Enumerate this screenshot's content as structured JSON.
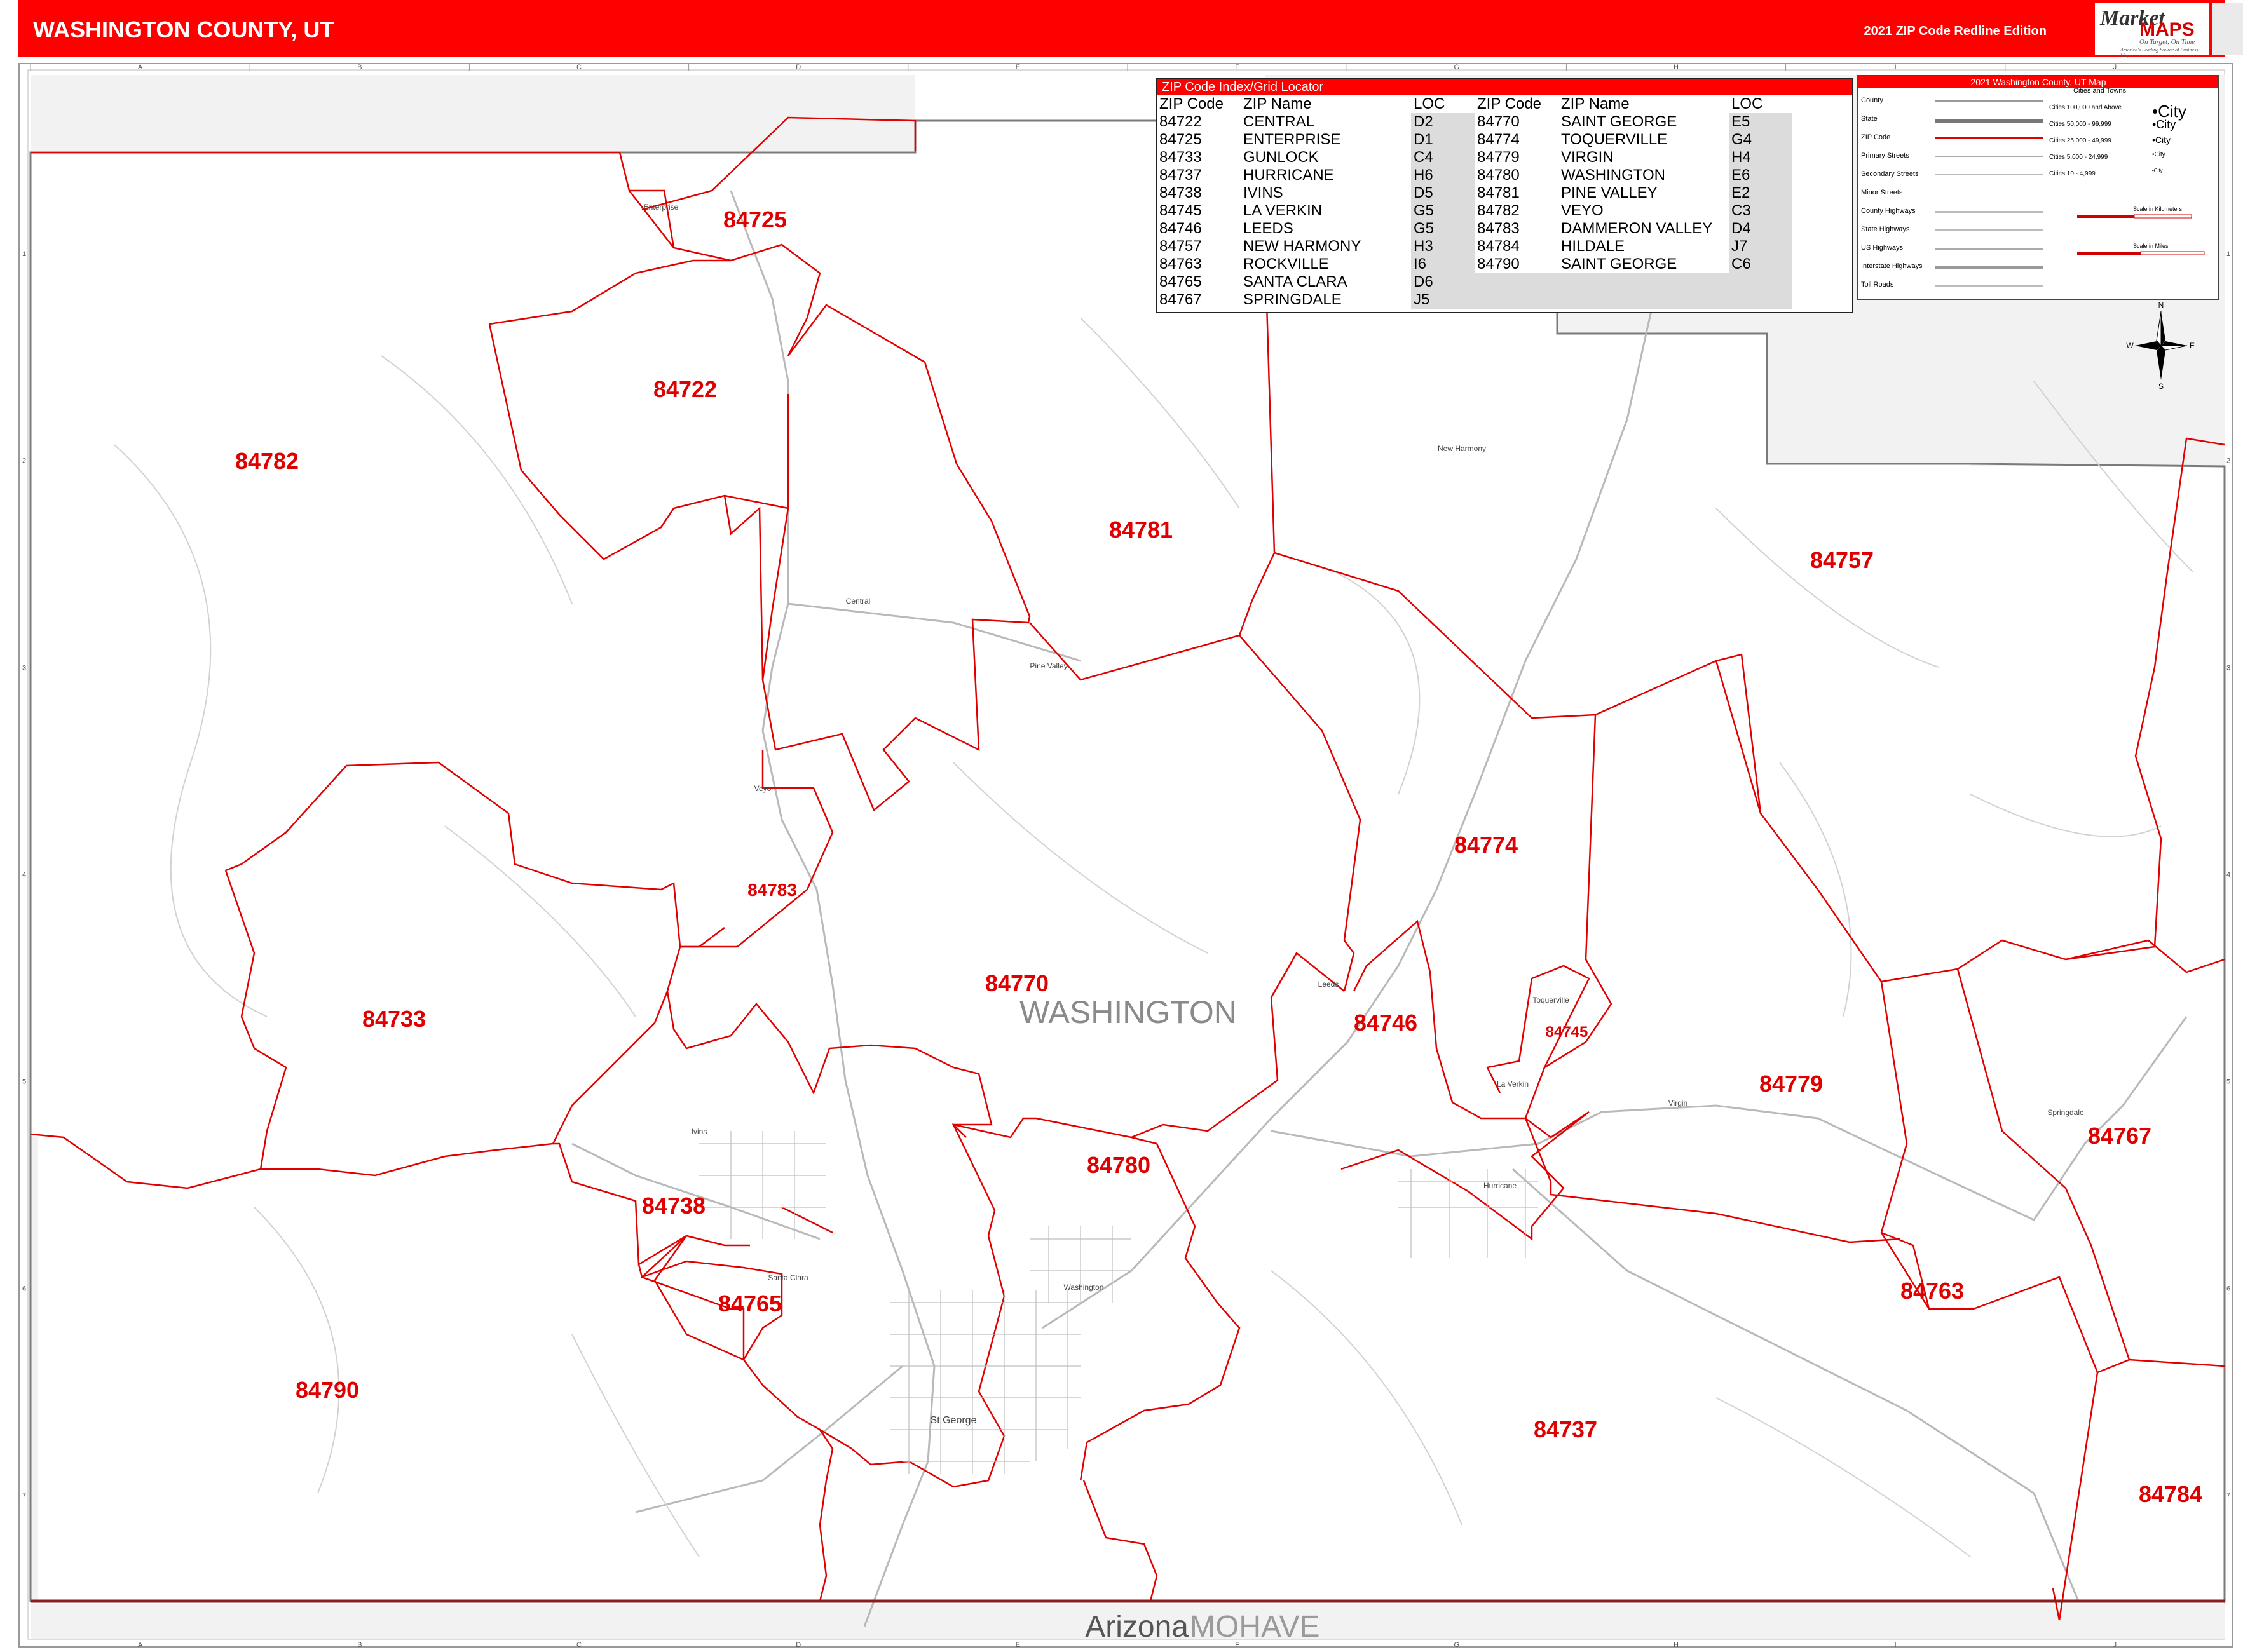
{
  "header": {
    "title": "WASHINGTON COUNTY, UT",
    "edition": "2021 ZIP Code Redline Edition",
    "logo": {
      "market": "Market",
      "maps": "MAPS",
      "tagline": "On Target, On Time",
      "subtagline": "America's Leading Source of Business Maps"
    }
  },
  "grid": {
    "columns": [
      "A",
      "B",
      "C",
      "D",
      "E",
      "F",
      "G",
      "H",
      "I",
      "J"
    ],
    "rows": [
      "1",
      "2",
      "3",
      "4",
      "5",
      "6",
      "7"
    ]
  },
  "map": {
    "county_label": "WASHINGTON",
    "state_label": "Arizona",
    "neighbor_county_label": "MOHAVE",
    "zip_labels": [
      "84725",
      "84722",
      "84782",
      "84781",
      "84757",
      "84774",
      "84783",
      "84733",
      "84770",
      "84746",
      "84745",
      "84779",
      "84767",
      "84780",
      "84738",
      "84765",
      "84763",
      "84790",
      "84737",
      "84784"
    ],
    "city_labels": [
      "St George",
      "Washington",
      "Hurricane",
      "La Verkin",
      "Toquerville",
      "Springdale",
      "Enterprise",
      "Central",
      "Veyo",
      "Ivins",
      "Santa Clara",
      "Pine Valley",
      "New Harmony",
      "Virgin",
      "Leeds"
    ],
    "colors": {
      "zip_boundary": "#e00000",
      "zip_label": "#e00000",
      "state_line": "#8a1e1e",
      "roads": "#b8b8b8",
      "outside_fill": "#f2f2f2"
    }
  },
  "index": {
    "title": "ZIP Code Index/Grid Locator",
    "headers": [
      "ZIP Code",
      "ZIP Name",
      "LOC",
      "ZIP Code",
      "ZIP Name",
      "LOC"
    ],
    "left": [
      [
        "84722",
        "CENTRAL",
        "D2"
      ],
      [
        "84725",
        "ENTERPRISE",
        "D1"
      ],
      [
        "84733",
        "GUNLOCK",
        "C4"
      ],
      [
        "84737",
        "HURRICANE",
        "H6"
      ],
      [
        "84738",
        "IVINS",
        "D5"
      ],
      [
        "84745",
        "LA VERKIN",
        "G5"
      ],
      [
        "84746",
        "LEEDS",
        "G5"
      ],
      [
        "84757",
        "NEW HARMONY",
        "H3"
      ],
      [
        "84763",
        "ROCKVILLE",
        "I6"
      ],
      [
        "84765",
        "SANTA CLARA",
        "D6"
      ],
      [
        "84767",
        "SPRINGDALE",
        "J5"
      ]
    ],
    "right": [
      [
        "84770",
        "SAINT GEORGE",
        "E5"
      ],
      [
        "84774",
        "TOQUERVILLE",
        "G4"
      ],
      [
        "84779",
        "VIRGIN",
        "H4"
      ],
      [
        "84780",
        "WASHINGTON",
        "E6"
      ],
      [
        "84781",
        "PINE VALLEY",
        "E2"
      ],
      [
        "84782",
        "VEYO",
        "C3"
      ],
      [
        "84783",
        "DAMMERON VALLEY",
        "D4"
      ],
      [
        "84784",
        "HILDALE",
        "J7"
      ],
      [
        "84790",
        "SAINT GEORGE",
        "C6"
      ]
    ]
  },
  "legend": {
    "title": "2021 Washington County, UT Map",
    "items": [
      "County",
      "State",
      "ZIP Code",
      "Primary Streets",
      "Secondary Streets",
      "Minor Streets",
      "County Highways",
      "State Highways",
      "US Highways",
      "Interstate Highways",
      "Toll Roads"
    ],
    "cities_header": "Cities and Towns",
    "cities": [
      "Cities 100,000 and Above",
      "Cities 50,000 - 99,999",
      "Cities 25,000 - 49,999",
      "Cities 5,000 - 24,999",
      "Cities 10 - 4,999"
    ],
    "city_samples": [
      "•City",
      "•City",
      "•City",
      "•City",
      "•City"
    ],
    "scale_km": "Scale in Kilometers",
    "scale_mi": "Scale in Miles",
    "compass": [
      "N",
      "S",
      "E",
      "W"
    ]
  }
}
